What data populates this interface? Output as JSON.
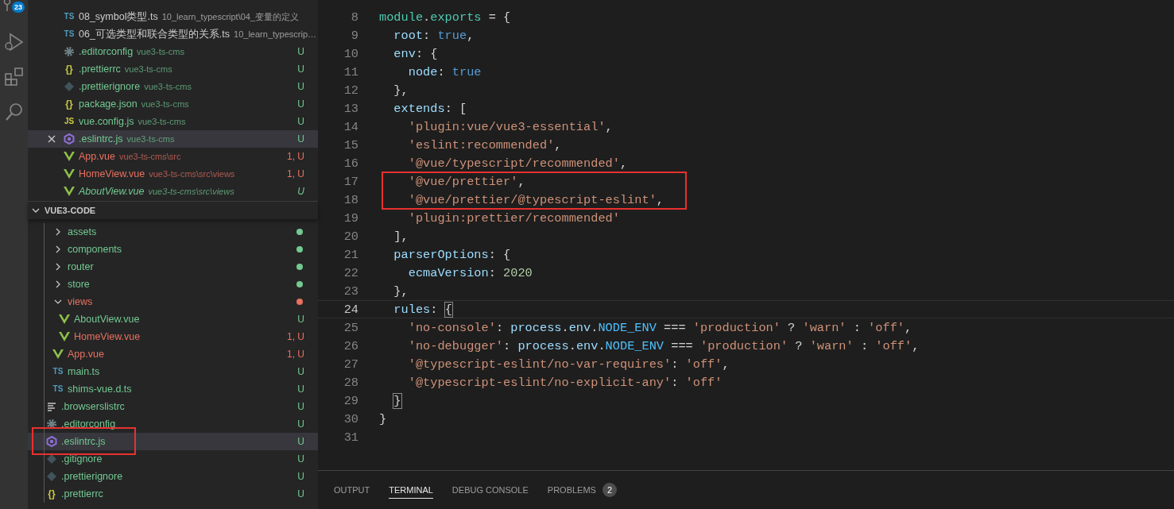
{
  "activity_bar": {
    "badge": "23"
  },
  "open_editors": [
    {
      "kind": "ts",
      "icon_label": "TS",
      "name": "08_symbol类型.ts",
      "description": "10_learn_typescript\\04_变量的定义",
      "color": "#cccccc",
      "selected": false,
      "preview": false
    },
    {
      "kind": "ts",
      "icon_label": "TS",
      "name": "06_可选类型和联合类型的关系.ts",
      "description": "10_learn_typescrip…",
      "color": "#cccccc",
      "selected": false,
      "preview": false
    },
    {
      "kind": "gear",
      "name": ".editorconfig",
      "description": "vue3-ts-cms",
      "status": "U",
      "color": "#73c991",
      "selected": false,
      "preview": false
    },
    {
      "kind": "braces",
      "icon_label": "{}",
      "name": ".prettierrc",
      "description": "vue3-ts-cms",
      "status": "U",
      "color": "#73c991",
      "selected": false,
      "preview": false
    },
    {
      "kind": "git",
      "name": ".prettierignore",
      "description": "vue3-ts-cms",
      "status": "U",
      "color": "#73c991",
      "selected": false,
      "preview": false
    },
    {
      "kind": "braces",
      "icon_label": "{}",
      "name": "package.json",
      "description": "vue3-ts-cms",
      "status": "U",
      "color": "#73c991",
      "selected": false,
      "preview": false
    },
    {
      "kind": "js",
      "icon_label": "JS",
      "name": "vue.config.js",
      "description": "vue3-ts-cms",
      "status": "U",
      "color": "#73c991",
      "selected": false,
      "preview": false
    },
    {
      "kind": "eslint",
      "name": ".eslintrc.js",
      "description": "vue3-ts-cms",
      "status": "U",
      "color": "#73c991",
      "selected": true,
      "preview": false
    },
    {
      "kind": "vue",
      "name": "App.vue",
      "description": "vue3-ts-cms\\src",
      "status": "1, U",
      "color": "#e8715f",
      "selected": false,
      "preview": false
    },
    {
      "kind": "vue",
      "name": "HomeView.vue",
      "description": "vue3-ts-cms\\src\\views",
      "status": "1, U",
      "color": "#e8715f",
      "selected": false,
      "preview": false
    },
    {
      "kind": "vue",
      "name": "AboutView.vue",
      "description": "vue3-ts-cms\\src\\views",
      "status": "U",
      "color": "#73c991",
      "selected": false,
      "preview": true
    }
  ],
  "explorer": {
    "title": "VUE3-CODE",
    "expanded": true,
    "nested_items": [
      {
        "kind": "folder",
        "name": "assets",
        "expanded": false,
        "color": "#73c991",
        "selected": false,
        "annotated": false
      },
      {
        "kind": "folder",
        "name": "components",
        "expanded": false,
        "color": "#73c991",
        "selected": false,
        "annotated": false
      },
      {
        "kind": "folder",
        "name": "router",
        "expanded": false,
        "color": "#73c991",
        "selected": false,
        "annotated": false
      },
      {
        "kind": "folder",
        "name": "store",
        "expanded": false,
        "color": "#73c991",
        "selected": false,
        "annotated": false
      },
      {
        "kind": "folder",
        "name": "views",
        "expanded": true,
        "color": "#e8715f",
        "selected": false,
        "annotated": false,
        "children": [
          {
            "kind": "vue",
            "name": "AboutView.vue",
            "status": "U",
            "color": "#73c991",
            "selected": false,
            "annotated": false
          },
          {
            "kind": "vue",
            "name": "HomeView.vue",
            "status": "1, U",
            "color": "#e8715f",
            "selected": false,
            "annotated": false
          }
        ]
      },
      {
        "kind": "vue",
        "name": "App.vue",
        "status": "1, U",
        "color": "#e8715f",
        "selected": false,
        "annotated": false
      },
      {
        "kind": "ts",
        "icon_label": "TS",
        "name": "main.ts",
        "status": "U",
        "color": "#73c991",
        "selected": false,
        "annotated": false
      },
      {
        "kind": "ts",
        "icon_label": "TS",
        "name": "shims-vue.d.ts",
        "status": "U",
        "color": "#73c991",
        "selected": false,
        "annotated": false
      }
    ],
    "root_items": [
      {
        "kind": "lines",
        "name": ".browserslistrc",
        "status": "U",
        "color": "#73c991",
        "selected": false,
        "annotated": false
      },
      {
        "kind": "gear",
        "name": ".editorconfig",
        "status": "U",
        "color": "#73c991",
        "selected": false,
        "annotated": false
      },
      {
        "kind": "eslint",
        "name": ".eslintrc.js",
        "status": "U",
        "color": "#73c991",
        "selected": true,
        "annotated": true
      },
      {
        "kind": "git",
        "name": ".gitignore",
        "status": "U",
        "color": "#73c991",
        "selected": false,
        "annotated": false
      },
      {
        "kind": "git",
        "name": ".prettierignore",
        "status": "U",
        "color": "#73c991",
        "selected": false,
        "annotated": false
      },
      {
        "kind": "braces",
        "icon_label": "{}",
        "name": ".prettierrc",
        "status": "U",
        "color": "#73c991",
        "selected": false,
        "annotated": false
      }
    ]
  },
  "code_lines": [
    {
      "number": "8",
      "current": false,
      "annotated": false,
      "tokens": [
        {
          "kind": "module",
          "text": "module"
        },
        {
          "kind": "punct",
          "text": "."
        },
        {
          "kind": "module",
          "text": "exports"
        },
        {
          "kind": "punct",
          "text": " = {"
        }
      ]
    },
    {
      "number": "9",
      "current": false,
      "annotated": false,
      "tokens": [
        {
          "kind": "key",
          "text": "  root"
        },
        {
          "kind": "punct",
          "text": ": "
        },
        {
          "kind": "keyword",
          "text": "true"
        },
        {
          "kind": "punct",
          "text": ","
        }
      ]
    },
    {
      "number": "10",
      "current": false,
      "annotated": false,
      "tokens": [
        {
          "kind": "key",
          "text": "  env"
        },
        {
          "kind": "punct",
          "text": ": {"
        }
      ]
    },
    {
      "number": "11",
      "current": false,
      "annotated": false,
      "tokens": [
        {
          "kind": "key",
          "text": "    node"
        },
        {
          "kind": "punct",
          "text": ": "
        },
        {
          "kind": "keyword",
          "text": "true"
        }
      ]
    },
    {
      "number": "12",
      "current": false,
      "annotated": false,
      "tokens": [
        {
          "kind": "punct",
          "text": "  },"
        }
      ]
    },
    {
      "number": "13",
      "current": false,
      "annotated": false,
      "tokens": [
        {
          "kind": "key",
          "text": "  extends"
        },
        {
          "kind": "punct",
          "text": ": ["
        }
      ]
    },
    {
      "number": "14",
      "current": false,
      "annotated": false,
      "tokens": [
        {
          "kind": "string",
          "text": "    'plugin:vue/vue3-essential'"
        },
        {
          "kind": "punct",
          "text": ","
        }
      ]
    },
    {
      "number": "15",
      "current": false,
      "annotated": false,
      "tokens": [
        {
          "kind": "string",
          "text": "    'eslint:recommended'"
        },
        {
          "kind": "punct",
          "text": ","
        }
      ]
    },
    {
      "number": "16",
      "current": false,
      "annotated": false,
      "tokens": [
        {
          "kind": "string",
          "text": "    '@vue/typescript/recommended'"
        },
        {
          "kind": "punct",
          "text": ","
        }
      ]
    },
    {
      "number": "17",
      "current": false,
      "annotated": true,
      "tokens": [
        {
          "kind": "string",
          "text": "    '@vue/prettier'"
        },
        {
          "kind": "punct",
          "text": ","
        }
      ]
    },
    {
      "number": "18",
      "current": false,
      "annotated": true,
      "tokens": [
        {
          "kind": "string",
          "text": "    '@vue/prettier/@typescript-eslint'"
        },
        {
          "kind": "punct",
          "text": ","
        }
      ]
    },
    {
      "number": "19",
      "current": false,
      "annotated": false,
      "tokens": [
        {
          "kind": "string",
          "text": "    'plugin:prettier/recommended'"
        }
      ]
    },
    {
      "number": "20",
      "current": false,
      "annotated": false,
      "tokens": [
        {
          "kind": "punct",
          "text": "  ],"
        }
      ]
    },
    {
      "number": "21",
      "current": false,
      "annotated": false,
      "tokens": [
        {
          "kind": "key",
          "text": "  parserOptions"
        },
        {
          "kind": "punct",
          "text": ": {"
        }
      ]
    },
    {
      "number": "22",
      "current": false,
      "annotated": false,
      "tokens": [
        {
          "kind": "key",
          "text": "    ecmaVersion"
        },
        {
          "kind": "punct",
          "text": ": "
        },
        {
          "kind": "number",
          "text": "2020"
        }
      ]
    },
    {
      "number": "23",
      "current": false,
      "annotated": false,
      "tokens": [
        {
          "kind": "punct",
          "text": "  },"
        }
      ]
    },
    {
      "number": "24",
      "current": true,
      "annotated": false,
      "tokens": [
        {
          "kind": "key",
          "text": "  rules"
        },
        {
          "kind": "punct",
          "text": ": "
        },
        {
          "kind": "match",
          "text": "{"
        }
      ]
    },
    {
      "number": "25",
      "current": false,
      "annotated": false,
      "tokens": [
        {
          "kind": "string",
          "text": "    'no-console'"
        },
        {
          "kind": "punct",
          "text": ": "
        },
        {
          "kind": "key",
          "text": "process"
        },
        {
          "kind": "punct",
          "text": "."
        },
        {
          "kind": "key",
          "text": "env"
        },
        {
          "kind": "punct",
          "text": "."
        },
        {
          "kind": "const",
          "text": "NODE_ENV"
        },
        {
          "kind": "punct",
          "text": " === "
        },
        {
          "kind": "string",
          "text": "'production'"
        },
        {
          "kind": "punct",
          "text": " ? "
        },
        {
          "kind": "string",
          "text": "'warn'"
        },
        {
          "kind": "punct",
          "text": " : "
        },
        {
          "kind": "string",
          "text": "'off'"
        },
        {
          "kind": "punct",
          "text": ","
        }
      ]
    },
    {
      "number": "26",
      "current": false,
      "annotated": false,
      "tokens": [
        {
          "kind": "string",
          "text": "    'no-debugger'"
        },
        {
          "kind": "punct",
          "text": ": "
        },
        {
          "kind": "key",
          "text": "process"
        },
        {
          "kind": "punct",
          "text": "."
        },
        {
          "kind": "key",
          "text": "env"
        },
        {
          "kind": "punct",
          "text": "."
        },
        {
          "kind": "const",
          "text": "NODE_ENV"
        },
        {
          "kind": "punct",
          "text": " === "
        },
        {
          "kind": "string",
          "text": "'production'"
        },
        {
          "kind": "punct",
          "text": " ? "
        },
        {
          "kind": "string",
          "text": "'warn'"
        },
        {
          "kind": "punct",
          "text": " : "
        },
        {
          "kind": "string",
          "text": "'off'"
        },
        {
          "kind": "punct",
          "text": ","
        }
      ]
    },
    {
      "number": "27",
      "current": false,
      "annotated": false,
      "tokens": [
        {
          "kind": "string",
          "text": "    '@typescript-eslint/no-var-requires'"
        },
        {
          "kind": "punct",
          "text": ": "
        },
        {
          "kind": "string",
          "text": "'off'"
        },
        {
          "kind": "punct",
          "text": ","
        }
      ]
    },
    {
      "number": "28",
      "current": false,
      "annotated": false,
      "tokens": [
        {
          "kind": "string",
          "text": "    '@typescript-eslint/no-explicit-any'"
        },
        {
          "kind": "punct",
          "text": ": "
        },
        {
          "kind": "string",
          "text": "'off'"
        }
      ]
    },
    {
      "number": "29",
      "current": false,
      "annotated": false,
      "tokens": [
        {
          "kind": "match",
          "text": "  }"
        }
      ]
    },
    {
      "number": "30",
      "current": false,
      "annotated": false,
      "tokens": [
        {
          "kind": "punct",
          "text": "}"
        }
      ]
    },
    {
      "number": "31",
      "current": false,
      "annotated": false
    }
  ],
  "panel": {
    "tabs": [
      {
        "label": "OUTPUT",
        "selected": false
      },
      {
        "label": "TERMINAL",
        "selected": true
      },
      {
        "label": "DEBUG CONSOLE",
        "selected": false
      },
      {
        "label": "PROBLEMS",
        "selected": false,
        "badge": "2"
      }
    ]
  }
}
